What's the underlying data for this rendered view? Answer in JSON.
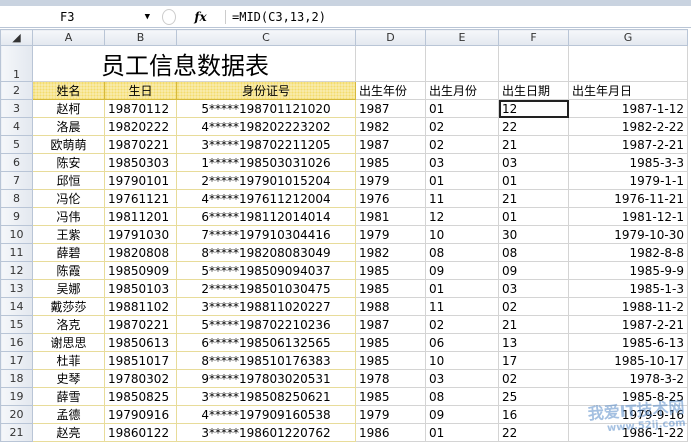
{
  "formula_bar": {
    "name_box": "F3",
    "fx": "fx",
    "formula": "=MID(C3,13,2)"
  },
  "columns": [
    "A",
    "B",
    "C",
    "D",
    "E",
    "F",
    "G"
  ],
  "title": "员工信息数据表",
  "headers": [
    "姓名",
    "生日",
    "身份证号",
    "出生年份",
    "出生月份",
    "出生日期",
    "出生年月日"
  ],
  "rows": [
    [
      "赵柯",
      "19870112",
      "5*****198701121020",
      "1987",
      "01",
      "12",
      "1987-1-12"
    ],
    [
      "洛晨",
      "19820222",
      "4*****198202223202",
      "1982",
      "02",
      "22",
      "1982-2-22"
    ],
    [
      "欧萌萌",
      "19870221",
      "3*****198702211205",
      "1987",
      "02",
      "21",
      "1987-2-21"
    ],
    [
      "陈安",
      "19850303",
      "1*****198503031026",
      "1985",
      "03",
      "03",
      "1985-3-3"
    ],
    [
      "邱恒",
      "19790101",
      "2*****197901015204",
      "1979",
      "01",
      "01",
      "1979-1-1"
    ],
    [
      "冯伦",
      "19761121",
      "4*****197611212004",
      "1976",
      "11",
      "21",
      "1976-11-21"
    ],
    [
      "冯伟",
      "19811201",
      "6*****198112014014",
      "1981",
      "12",
      "01",
      "1981-12-1"
    ],
    [
      "王紫",
      "19791030",
      "7*****197910304416",
      "1979",
      "10",
      "30",
      "1979-10-30"
    ],
    [
      "薛碧",
      "19820808",
      "8*****198208083049",
      "1982",
      "08",
      "08",
      "1982-8-8"
    ],
    [
      "陈霞",
      "19850909",
      "5*****198509094037",
      "1985",
      "09",
      "09",
      "1985-9-9"
    ],
    [
      "吴娜",
      "19850103",
      "2*****198501030475",
      "1985",
      "01",
      "03",
      "1985-1-3"
    ],
    [
      "戴莎莎",
      "19881102",
      "3*****198811020227",
      "1988",
      "11",
      "02",
      "1988-11-2"
    ],
    [
      "洛克",
      "19870221",
      "5*****198702210236",
      "1987",
      "02",
      "21",
      "1987-2-21"
    ],
    [
      "谢思思",
      "19850613",
      "6*****198506132565",
      "1985",
      "06",
      "13",
      "1985-6-13"
    ],
    [
      "杜菲",
      "19851017",
      "8*****198510176383",
      "1985",
      "10",
      "17",
      "1985-10-17"
    ],
    [
      "史琴",
      "19780302",
      "9*****197803020531",
      "1978",
      "03",
      "02",
      "1978-3-2"
    ],
    [
      "薛雪",
      "19850825",
      "3*****198508250621",
      "1985",
      "08",
      "25",
      "1985-8-25"
    ],
    [
      "孟德",
      "19790916",
      "4*****197909160538",
      "1979",
      "09",
      "16",
      "1979-9-16"
    ],
    [
      "赵亮",
      "19860122",
      "3*****198601220762",
      "1986",
      "01",
      "22",
      "1986-1-22"
    ]
  ],
  "watermark": {
    "text": "我爱IT技术网",
    "url": "www.52ij.com"
  }
}
